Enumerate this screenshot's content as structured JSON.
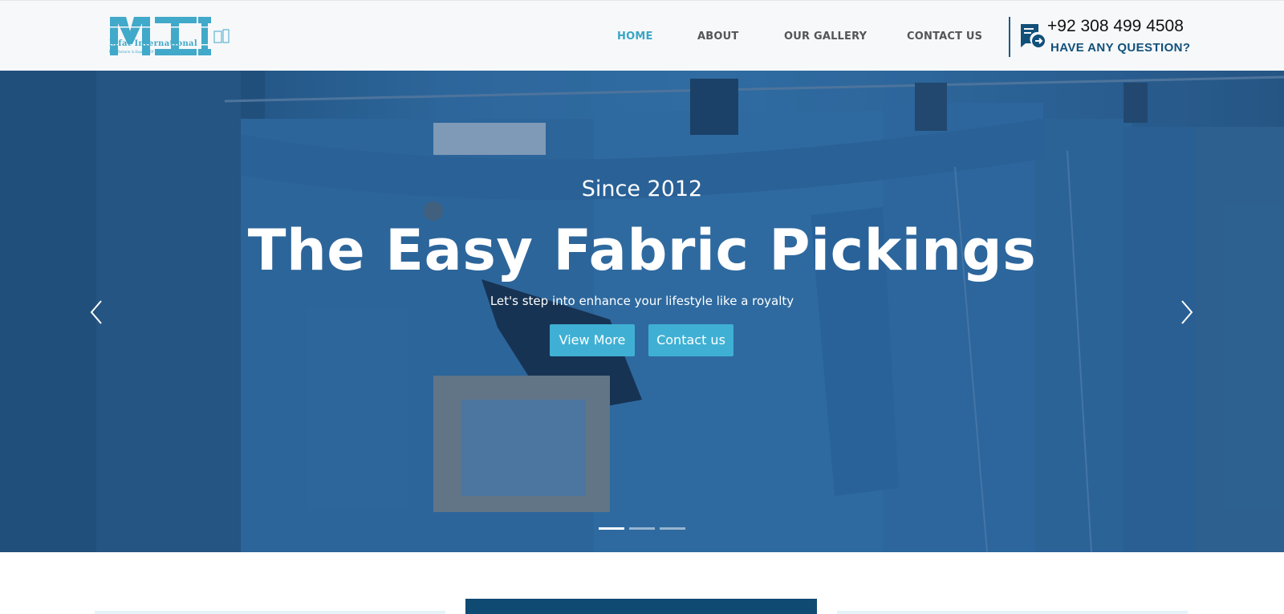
{
  "header": {
    "logo_name": "Mfat International",
    "logo_tagline": "Manufacturer & Exporter Of Clothing",
    "nav": [
      {
        "label": "HOME",
        "active": true
      },
      {
        "label": "ABOUT",
        "active": false
      },
      {
        "label": "OUR GALLERY",
        "active": false
      },
      {
        "label": "CONTACT US",
        "active": false
      }
    ],
    "phone": "+92 308 499 4508",
    "question": "HAVE ANY QUESTION?"
  },
  "hero": {
    "since": "Since 2012",
    "title": "The Easy Fabric Pickings",
    "tagline": "Let's step into enhance your lifestyle like a royalty",
    "buttons": {
      "view_more": "View More",
      "contact": "Contact us"
    },
    "slides": {
      "count": 3,
      "active": 1
    }
  },
  "colors": {
    "accent": "#3fb0d4",
    "nav_active": "#3aa5c7",
    "navy": "#12507a",
    "header_bg": "#f6f8fa"
  },
  "icons": [
    "question-chat-icon",
    "chevron-left-icon",
    "chevron-right-icon"
  ]
}
